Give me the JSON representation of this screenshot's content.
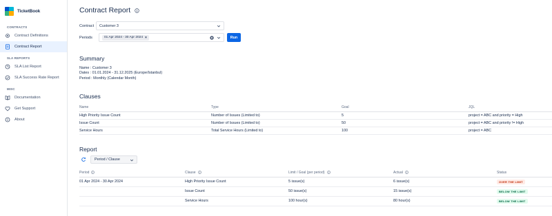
{
  "app": {
    "name": "TicketBook"
  },
  "sidebar": {
    "sections": [
      {
        "title": "CONTRACTS",
        "items": [
          {
            "label": "Contract Definitions",
            "icon": "gear-icon",
            "active": false
          },
          {
            "label": "Contract Report",
            "icon": "report-icon",
            "active": true
          }
        ]
      },
      {
        "title": "SLA REPORTS",
        "items": [
          {
            "label": "SLA List Report",
            "icon": "list-icon",
            "active": false
          },
          {
            "label": "SLA Success Rate Report",
            "icon": "gauge-icon",
            "active": false
          }
        ]
      },
      {
        "title": "MISC",
        "items": [
          {
            "label": "Documentation",
            "icon": "book-icon",
            "active": false
          },
          {
            "label": "Get Support",
            "icon": "support-icon",
            "active": false
          },
          {
            "label": "About",
            "icon": "info-icon",
            "active": false
          }
        ]
      }
    ]
  },
  "page": {
    "title": "Contract Report"
  },
  "form": {
    "contract_label": "Contract",
    "contract_value": "Customer 3",
    "periods_label": "Periods",
    "period_chip": "01 Apr 2024 - 30 Apr 2024",
    "run_label": "Run"
  },
  "summary": {
    "title": "Summary",
    "name": "Name : Customer 3",
    "dates": "Dates : 01.01.2024 - 31.12.2025 (Europe/Istanbul)",
    "period": "Period : Monthly (Calendar Month)"
  },
  "clauses": {
    "title": "Clauses",
    "headers": [
      "Name",
      "Type",
      "Goal",
      "JQL"
    ],
    "rows": [
      [
        "High Priority Issue Count",
        "Number of Issues (Limited to)",
        "5",
        "project = ABC and priority = High"
      ],
      [
        "Issue Count",
        "Number of Issues (Limited to)",
        "50",
        "project = ABC and priority != High"
      ],
      [
        "Service Hours",
        "Total Service Hours (Limited to)",
        "100",
        "project = ABC"
      ]
    ]
  },
  "report": {
    "title": "Report",
    "group_by": "Period / Clause",
    "headers": [
      "Period",
      "Clause",
      "Limit / Goal (per period)",
      "Actual",
      "Status"
    ],
    "rows": [
      {
        "period": "01 Apr 2024 - 30 Apr 2024",
        "clause": "High Priority Issue Count",
        "limit": "5 issue(s)",
        "actual": "6 issue(s)",
        "status": "OVER THE LIMIT",
        "status_type": "over"
      },
      {
        "period": "",
        "clause": "Issue Count",
        "limit": "50 issue(s)",
        "actual": "15 issue(s)",
        "status": "BELOW THE LIMIT",
        "status_type": "below"
      },
      {
        "period": "",
        "clause": "Service Hours",
        "limit": "100 hour(s)",
        "actual": "80 hour(s)",
        "status": "BELOW THE LIMIT",
        "status_type": "below"
      }
    ]
  },
  "colors": {
    "primary": "#0c66e4",
    "active_bg": "#e9f2ff",
    "over_bg": "#ffebe6",
    "over_fg": "#bf2600",
    "below_bg": "#e3fcef",
    "below_fg": "#006644"
  }
}
